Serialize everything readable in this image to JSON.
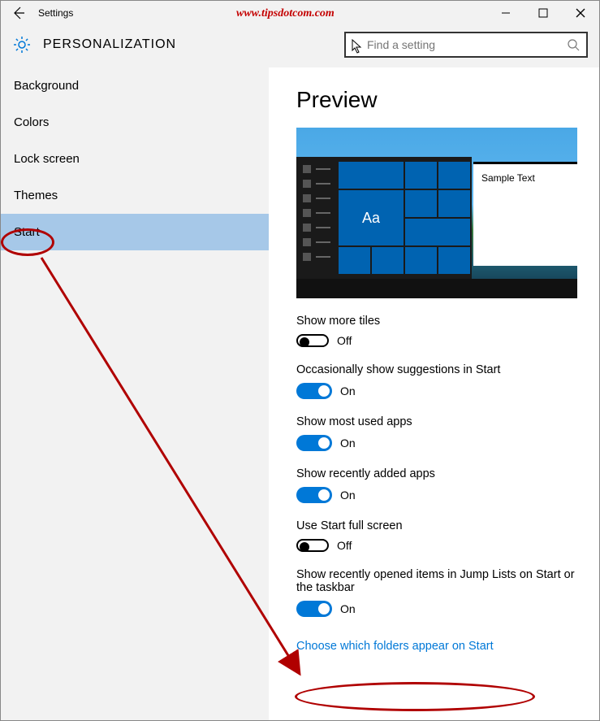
{
  "titlebar": {
    "title": "Settings"
  },
  "watermark": "www.tipsdotcom.com",
  "header": {
    "page_title": "PERSONALIZATION"
  },
  "search": {
    "placeholder": "Find a setting"
  },
  "sidebar": {
    "items": [
      {
        "label": "Background",
        "selected": false
      },
      {
        "label": "Colors",
        "selected": false
      },
      {
        "label": "Lock screen",
        "selected": false
      },
      {
        "label": "Themes",
        "selected": false
      },
      {
        "label": "Start",
        "selected": true
      }
    ]
  },
  "main": {
    "preview_heading": "Preview",
    "sample_text": "Sample Text",
    "aa_label": "Aa",
    "settings": [
      {
        "label": "Show more tiles",
        "on": false,
        "state": "Off"
      },
      {
        "label": "Occasionally show suggestions in Start",
        "on": true,
        "state": "On"
      },
      {
        "label": "Show most used apps",
        "on": true,
        "state": "On"
      },
      {
        "label": "Show recently added apps",
        "on": true,
        "state": "On"
      },
      {
        "label": "Use Start full screen",
        "on": false,
        "state": "Off"
      },
      {
        "label": "Show recently opened items in Jump Lists on Start or the taskbar",
        "on": true,
        "state": "On"
      }
    ],
    "link": "Choose which folders appear on Start"
  }
}
